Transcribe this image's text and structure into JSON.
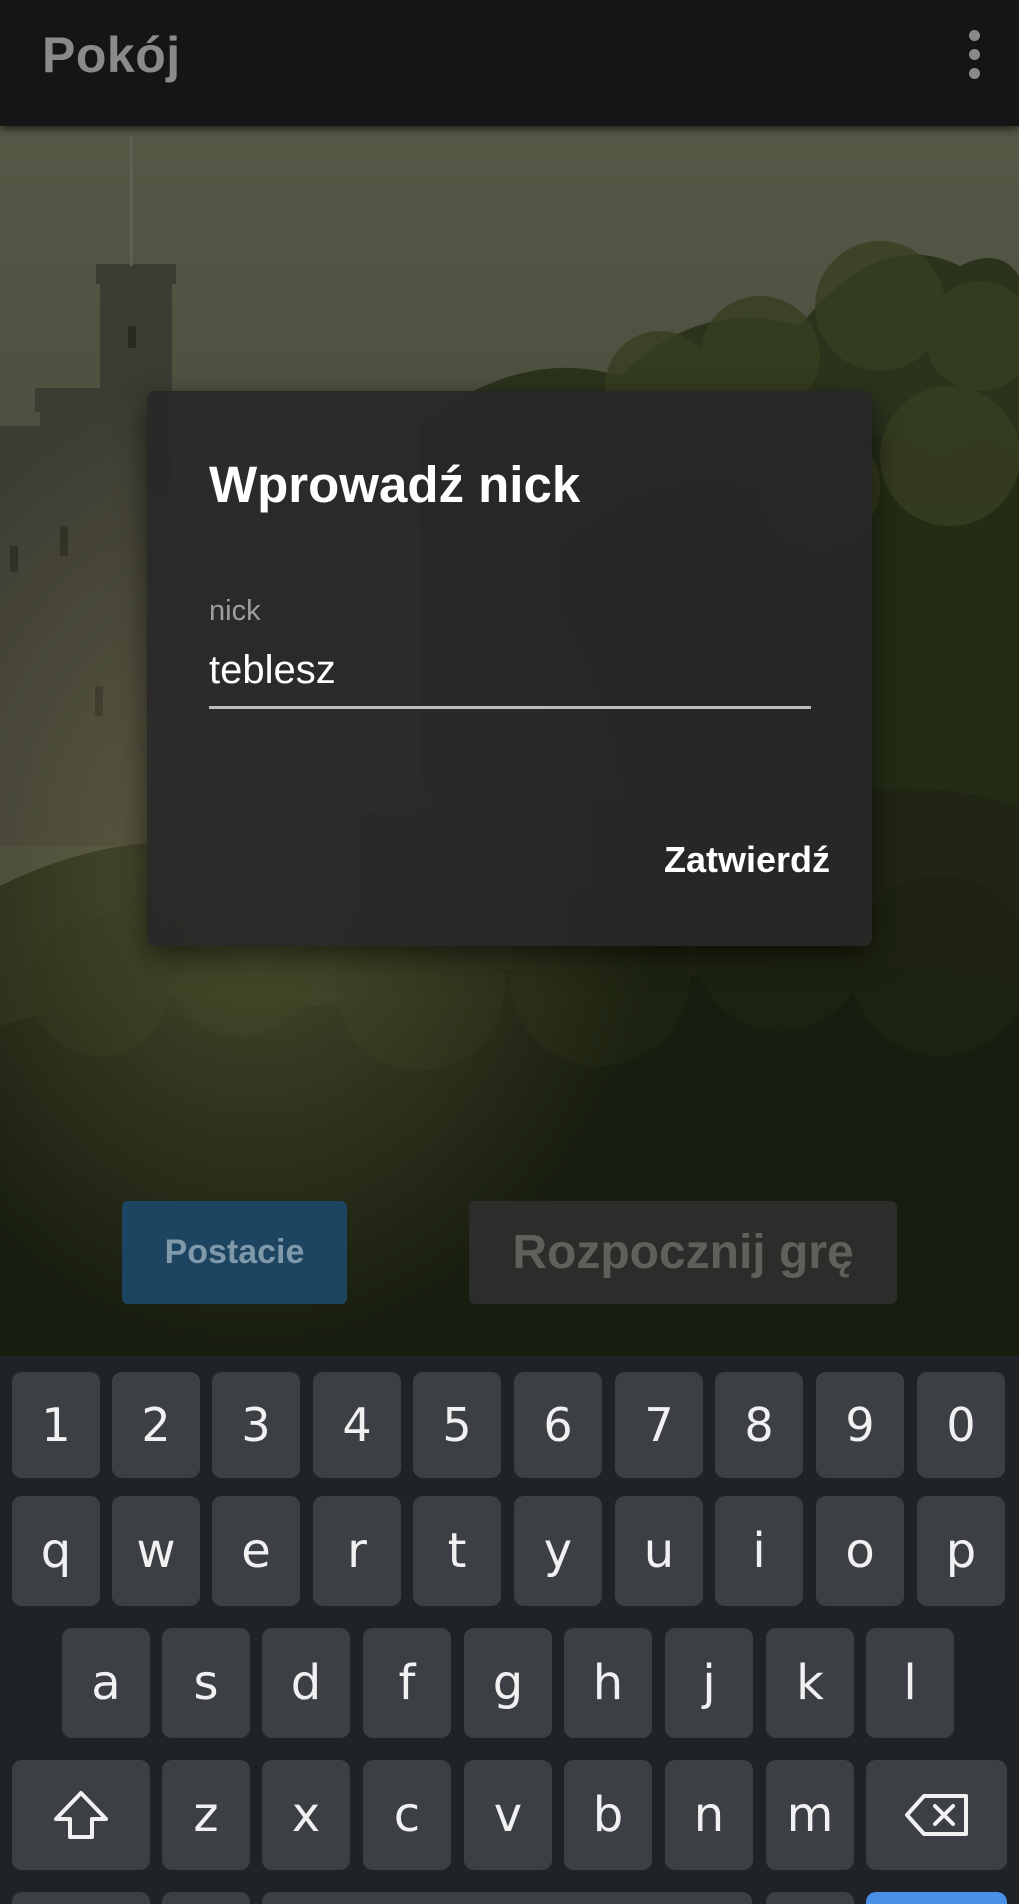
{
  "appbar": {
    "title": "Pokój",
    "menu_icon": "more-vert-icon"
  },
  "room": {
    "characters_button": "Postacie",
    "start_button": "Rozpocznij grę",
    "background": "castle-on-wooded-hill"
  },
  "dialog": {
    "title": "Wprowadź nick",
    "field_label": "nick",
    "field_value": "teblesz",
    "confirm_button": "Zatwierdź"
  },
  "keyboard": {
    "row_digits": [
      "1",
      "2",
      "3",
      "4",
      "5",
      "6",
      "7",
      "8",
      "9",
      "0"
    ],
    "row_1": [
      "q",
      "w",
      "e",
      "r",
      "t",
      "y",
      "u",
      "i",
      "o",
      "p"
    ],
    "row_2": [
      "a",
      "s",
      "d",
      "f",
      "g",
      "h",
      "j",
      "k",
      "l"
    ],
    "row_3": [
      "z",
      "x",
      "c",
      "v",
      "b",
      "n",
      "m"
    ],
    "shift_icon": "shift-icon",
    "backspace_icon": "backspace-icon"
  },
  "colors": {
    "appbar": "#151515",
    "dialog": "#282828",
    "primary_button": "#1d4460",
    "keyboard": "#1f2327",
    "key": "#3c4045",
    "accent_key": "#4a8fe8"
  }
}
